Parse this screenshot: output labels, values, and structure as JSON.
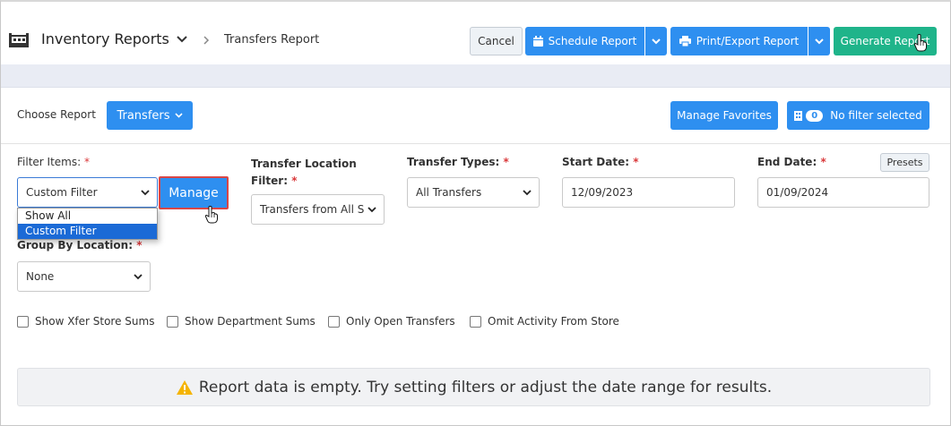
{
  "header": {
    "title": "Inventory Reports",
    "breadcrumb": "Transfers Report",
    "cancel_label": "Cancel",
    "schedule_label": "Schedule Report",
    "print_label": "Print/Export Report",
    "generate_label": "Generate Report",
    "icons": [
      "store-icon",
      "chevron-down-icon",
      "chevron-right-icon",
      "calendar-icon",
      "printer-icon",
      "caret-down-icon"
    ]
  },
  "choose": {
    "label": "Choose Report",
    "report_label": "Transfers",
    "manage_favorites_label": "Manage Favorites",
    "filter_count": "0",
    "filter_status": "No filter selected"
  },
  "filters": {
    "filter_items_label": "Filter Items:",
    "filter_items_value": "Custom Filter",
    "manage_label": "Manage",
    "filter_items_options": [
      "Show All",
      "Custom Filter"
    ],
    "location_label_line1": "Transfer Location",
    "location_label_line2": "Filter:",
    "location_value": "Transfers from All S",
    "types_label": "Transfer Types:",
    "types_value": "All Transfers",
    "start_label": "Start Date:",
    "start_value": "12/09/2023",
    "end_label": "End Date:",
    "end_value": "01/09/2024",
    "presets_label": "Presets",
    "group_label": "Group By Location:",
    "group_value": "None",
    "required_mark": "*"
  },
  "options": {
    "show_xfer_store_sums": "Show Xfer Store Sums",
    "show_department_sums": "Show Department Sums",
    "only_open_transfers": "Only Open Transfers",
    "omit_activity_from_store": "Omit Activity From Store"
  },
  "message": {
    "empty_text": "Report data is empty. Try setting filters or adjust the date range for results."
  },
  "colors": {
    "primary": "#2e8ff0",
    "success": "#1fb48a",
    "required": "#d9383a",
    "highlight": "#d94646",
    "warning": "#f5b400"
  }
}
